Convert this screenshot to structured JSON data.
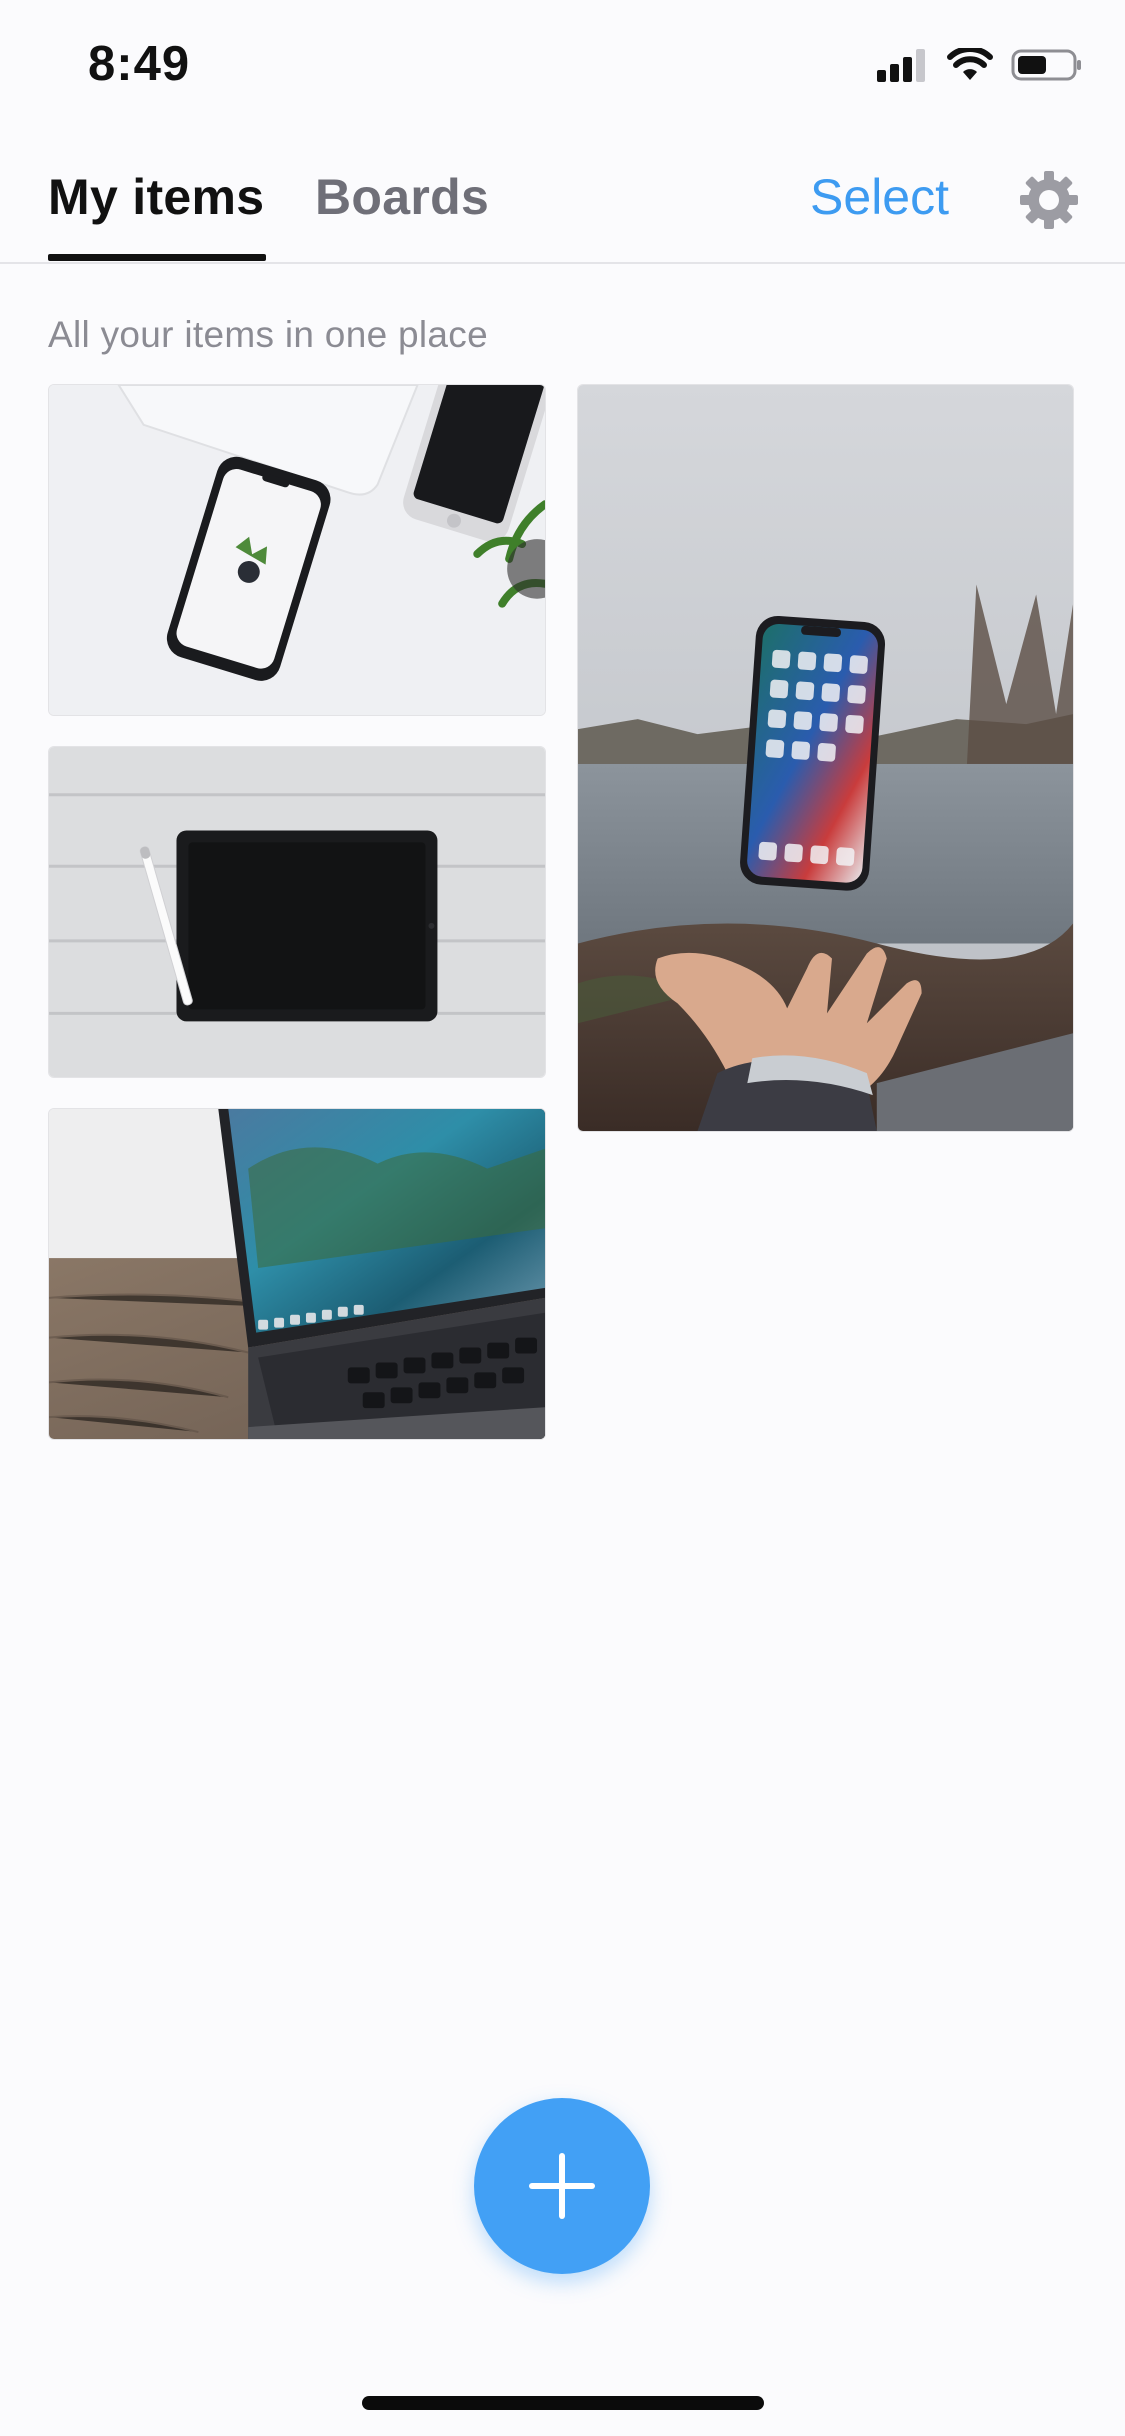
{
  "status_bar": {
    "time": "8:49",
    "icons": [
      "signal-icon",
      "wifi-icon",
      "battery-icon"
    ]
  },
  "tabs": [
    {
      "label": "My items",
      "active": true
    },
    {
      "label": "Boards",
      "active": false
    }
  ],
  "header": {
    "select_label": "Select",
    "settings_icon": "gear-icon"
  },
  "subtitle": "All your items in one place",
  "items": [
    {
      "description": "phones-on-white-desk-photo"
    },
    {
      "description": "phone-floating-over-hand-by-lake-photo"
    },
    {
      "description": "tablet-and-pencil-on-wood-photo"
    },
    {
      "description": "laptop-on-wooden-table-photo"
    }
  ],
  "fab": {
    "icon": "plus-icon"
  },
  "colors": {
    "accent": "#42a0f5",
    "select_text": "#3d9bf1",
    "active_tab": "#111111",
    "inactive_tab": "#6f6f78",
    "subtitle": "#8b8b93",
    "background": "#fbfbfd"
  }
}
